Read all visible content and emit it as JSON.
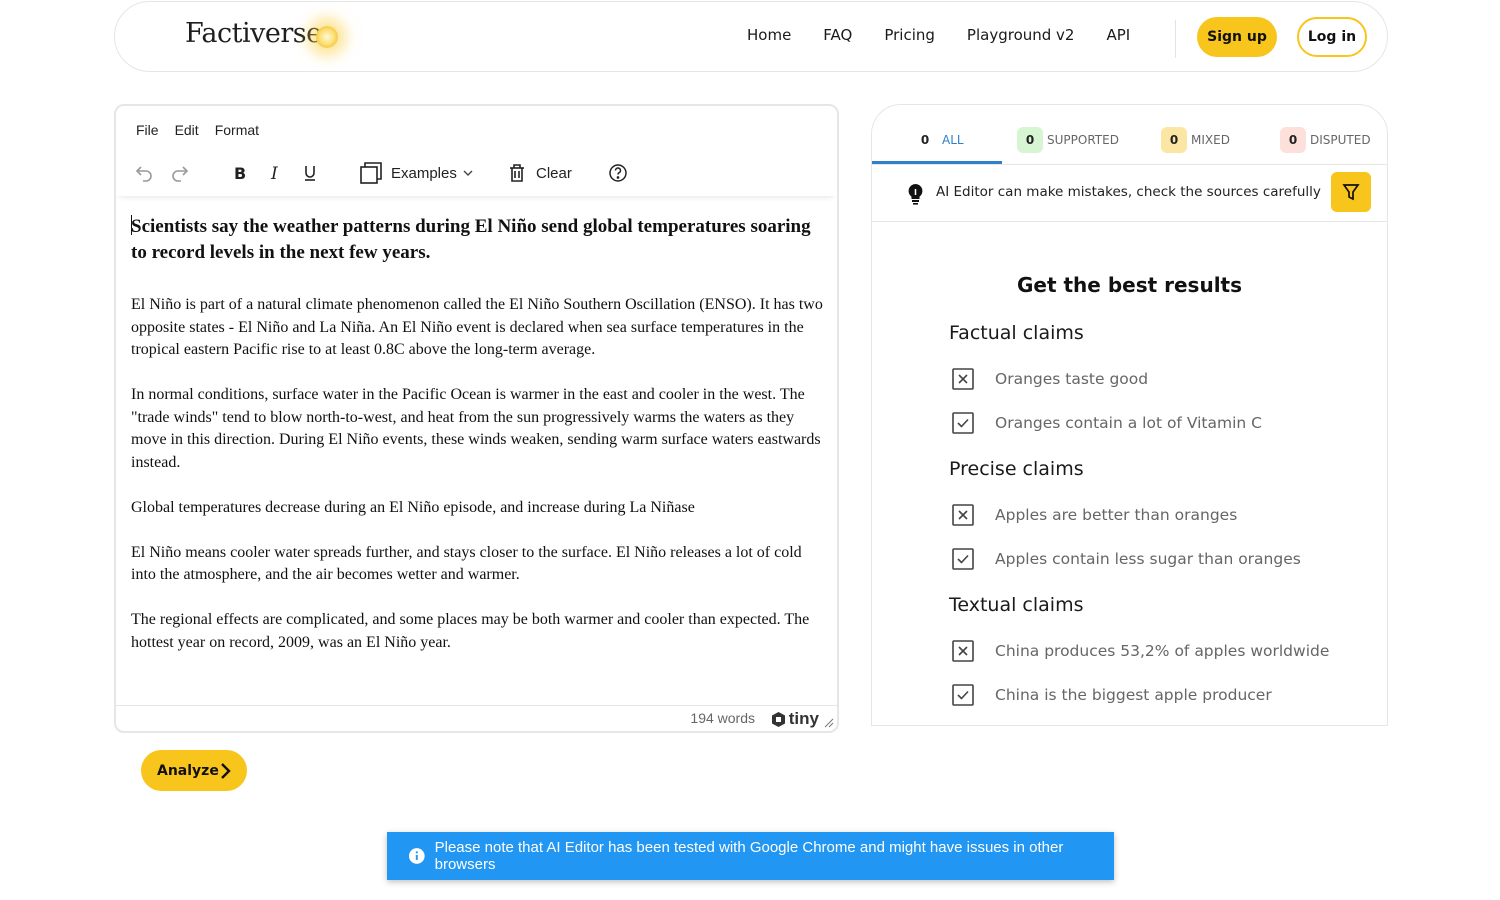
{
  "header": {
    "logo": "Factiverse",
    "nav": [
      "Home",
      "FAQ",
      "Pricing",
      "Playground v2",
      "API"
    ],
    "signup": "Sign up",
    "login": "Log in"
  },
  "editor": {
    "menu": [
      "File",
      "Edit",
      "Format"
    ],
    "toolbar": {
      "examples": "Examples",
      "clear": "Clear"
    },
    "title": "Scientists say the weather patterns during El Niño send global temperatures soaring to record levels in the next few years.",
    "paragraphs": [
      "El Niño is part of a natural climate phenomenon called the El Niño Southern Oscillation (ENSO). It has two opposite states - El Niño and La Niña. An El Niño event is declared when sea surface temperatures in the tropical eastern Pacific rise to at least 0.8C above the long-term average.",
      "In normal conditions, surface water in the Pacific Ocean is warmer in the east and cooler in the west. The \"trade winds\" tend to blow north-to-west, and heat from the sun progressively warms the waters as they move in this direction. During El Niño events, these winds weaken, sending warm surface waters eastwards instead.",
      "Global temperatures decrease during an El Niño episode, and increase during La Niñase",
      "El Niño means cooler water spreads further, and stays closer to the surface. El Niño releases a lot of cold into the atmosphere, and the air becomes wetter and warmer.",
      "The regional effects are complicated, and some places may be both warmer and cooler than expected. The hottest year on record, 2009, was an El Niño year."
    ],
    "word_count": "194 words",
    "brand": "tiny"
  },
  "analyze": "Analyze",
  "panel": {
    "tabs": [
      {
        "count": "0",
        "label": "ALL",
        "color": "#ffffff"
      },
      {
        "count": "0",
        "label": "SUPPORTED",
        "color": "#d7f5d3"
      },
      {
        "count": "0",
        "label": "MIXED",
        "color": "#fbe7a3"
      },
      {
        "count": "0",
        "label": "DISPUTED",
        "color": "#fde0d9"
      }
    ],
    "notice": "AI Editor can make mistakes, check the sources carefully",
    "best_title": "Get the best results",
    "sections": [
      {
        "title": "Factual claims",
        "items": [
          {
            "text": "Oranges taste good",
            "icon": "x-box-icon"
          },
          {
            "text": "Oranges contain a lot of Vitamin C",
            "icon": "check-box-icon"
          }
        ]
      },
      {
        "title": "Precise claims",
        "items": [
          {
            "text": "Apples are better than oranges",
            "icon": "x-box-icon"
          },
          {
            "text": "Apples contain less sugar than oranges",
            "icon": "check-box-icon"
          }
        ]
      },
      {
        "title": "Textual claims",
        "items": [
          {
            "text": "China produces 53,2% of apples worldwide",
            "icon": "x-box-icon"
          },
          {
            "text": "China is the biggest apple producer",
            "icon": "check-box-icon"
          }
        ]
      }
    ]
  },
  "toast": "Please note that AI Editor has been tested with Google Chrome and might have issues in other browsers",
  "colors": {
    "accent": "#f7c51c",
    "tab_active": "#2f80c9",
    "toast": "#2196f3"
  }
}
